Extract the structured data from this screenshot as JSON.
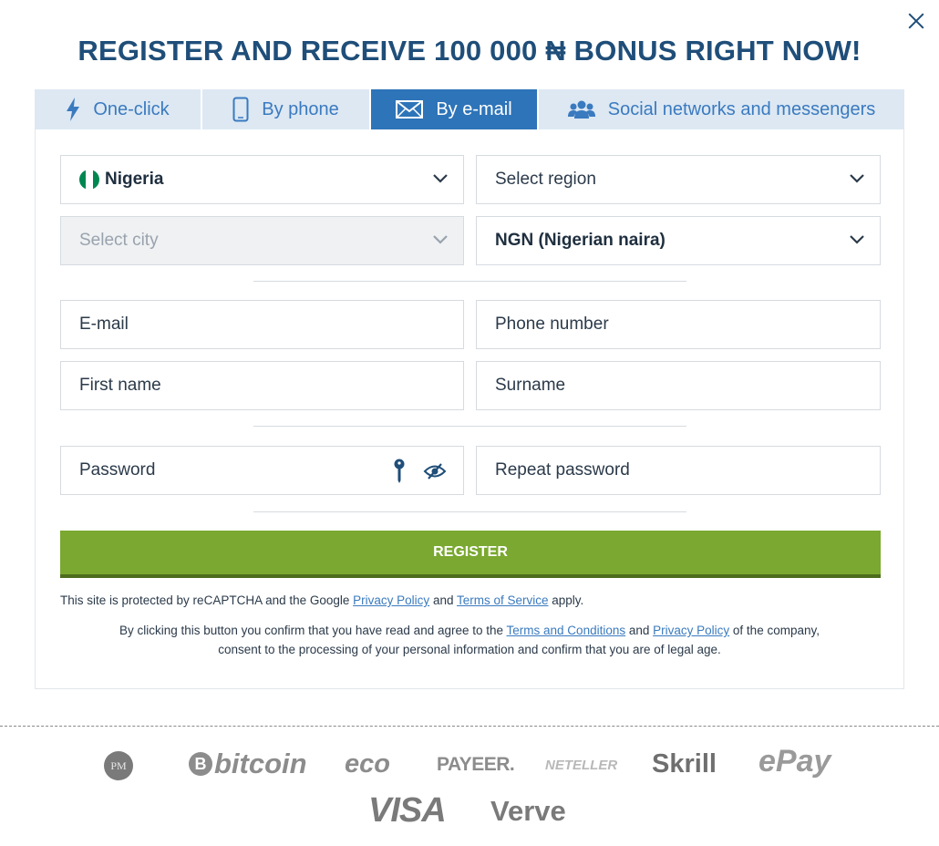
{
  "header": {
    "title": "REGISTER AND RECEIVE 100 000 ₦ BONUS RIGHT NOW!"
  },
  "tabs": [
    {
      "label": "One-click",
      "icon": "lightning-icon",
      "active": false
    },
    {
      "label": "By phone",
      "icon": "phone-icon",
      "active": false
    },
    {
      "label": "By e-mail",
      "icon": "envelope-icon",
      "active": true
    },
    {
      "label": "Social networks and messengers",
      "icon": "users-icon",
      "active": false
    }
  ],
  "form": {
    "country": {
      "value": "Nigeria",
      "flag_colors": [
        "#008751",
        "#ffffff",
        "#008751"
      ]
    },
    "region": {
      "placeholder": "Select region"
    },
    "city": {
      "placeholder": "Select city"
    },
    "currency": {
      "value": "NGN (Nigerian naira)"
    },
    "email": {
      "placeholder": "E-mail"
    },
    "phone": {
      "placeholder": "Phone number"
    },
    "first_name": {
      "placeholder": "First name"
    },
    "surname": {
      "placeholder": "Surname"
    },
    "password": {
      "placeholder": "Password"
    },
    "repeat_password": {
      "placeholder": "Repeat password"
    },
    "register_label": "REGISTER"
  },
  "recaptcha": {
    "text_before": "This site is protected by reCAPTCHA and the Google ",
    "privacy_link": "Privacy Policy",
    "and": " and ",
    "terms_link": "Terms of Service",
    "text_after": " apply."
  },
  "consent": {
    "line1_before": "By clicking this button you confirm that you have read and agree to the ",
    "terms_link": "Terms and Conditions",
    "and": " and ",
    "privacy_link": "Privacy Policy",
    "line1_after": " of the company,",
    "line2": "consent to the processing of your personal information and confirm that you are of legal age."
  },
  "payments": {
    "pm": "PM",
    "bitcoin": "bitcoin",
    "eco": "eco",
    "payeer": "PAYEER.",
    "neteller": "NETELLER",
    "skrill": "Skrill",
    "epay": "ePay",
    "visa": "VISA",
    "verve": "Verve"
  },
  "colors": {
    "brand_blue": "#1f4e79",
    "tab_active": "#2e74b8",
    "tab_inactive": "#dde8f3",
    "register_green": "#7aa830",
    "link": "#3a7abf"
  }
}
